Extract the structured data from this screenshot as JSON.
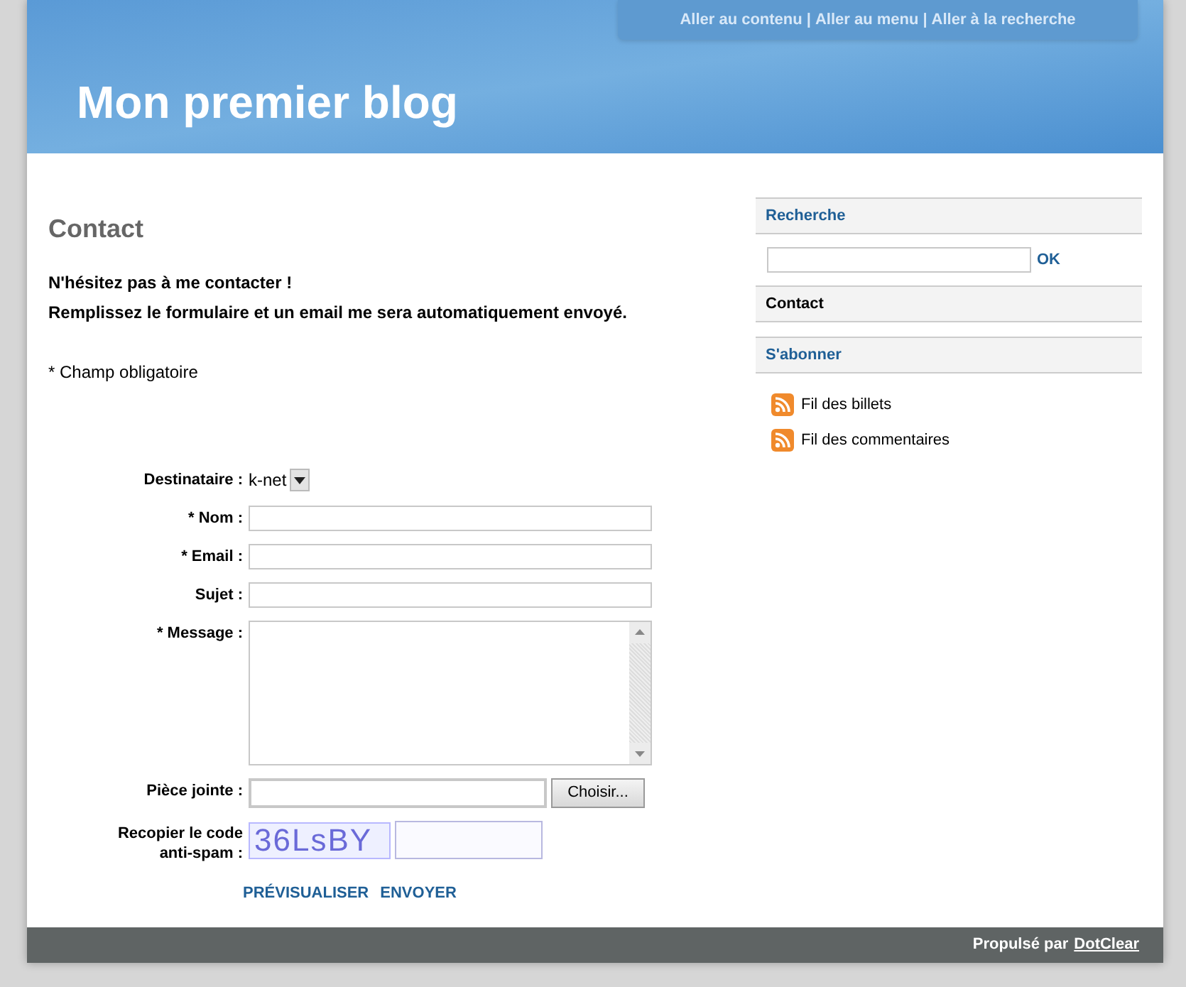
{
  "skip_links": [
    {
      "label": "Aller au contenu"
    },
    {
      "label": "Aller au menu"
    },
    {
      "label": "Aller à la recherche"
    }
  ],
  "skip_separator": "|",
  "blog_title": "Mon premier blog",
  "page": {
    "title": "Contact",
    "intro": [
      "N'hésitez pas à me contacter !",
      "Remplissez le formulaire et un email me sera automatiquement envoyé."
    ],
    "required_note": "* Champ obligatoire"
  },
  "form": {
    "fields": [
      {
        "kind": "select",
        "label": "Destinataire :",
        "value": "k-net"
      },
      {
        "kind": "text",
        "label": "* Nom :"
      },
      {
        "kind": "text",
        "label": "* Email :"
      },
      {
        "kind": "text",
        "label": "Sujet :"
      },
      {
        "kind": "textarea",
        "label": "* Message :"
      },
      {
        "kind": "file",
        "label": "Pièce jointe :",
        "button": "Choisir..."
      },
      {
        "kind": "captcha",
        "label": "Recopier le code anti-spam :",
        "code": "36LsBY"
      }
    ],
    "actions": [
      "PRÉVISUALISER",
      "ENVOYER"
    ]
  },
  "sidebar": {
    "widgets": [
      {
        "title": "Recherche",
        "link": true,
        "kind": "search",
        "button": "OK"
      },
      {
        "title": "Contact",
        "link": false,
        "kind": "none"
      },
      {
        "title": "S'abonner",
        "link": true,
        "kind": "feeds",
        "items": [
          "Fil des billets",
          "Fil des commentaires"
        ]
      }
    ]
  },
  "footer": {
    "text": "Propulsé par",
    "link": "DotClear"
  }
}
